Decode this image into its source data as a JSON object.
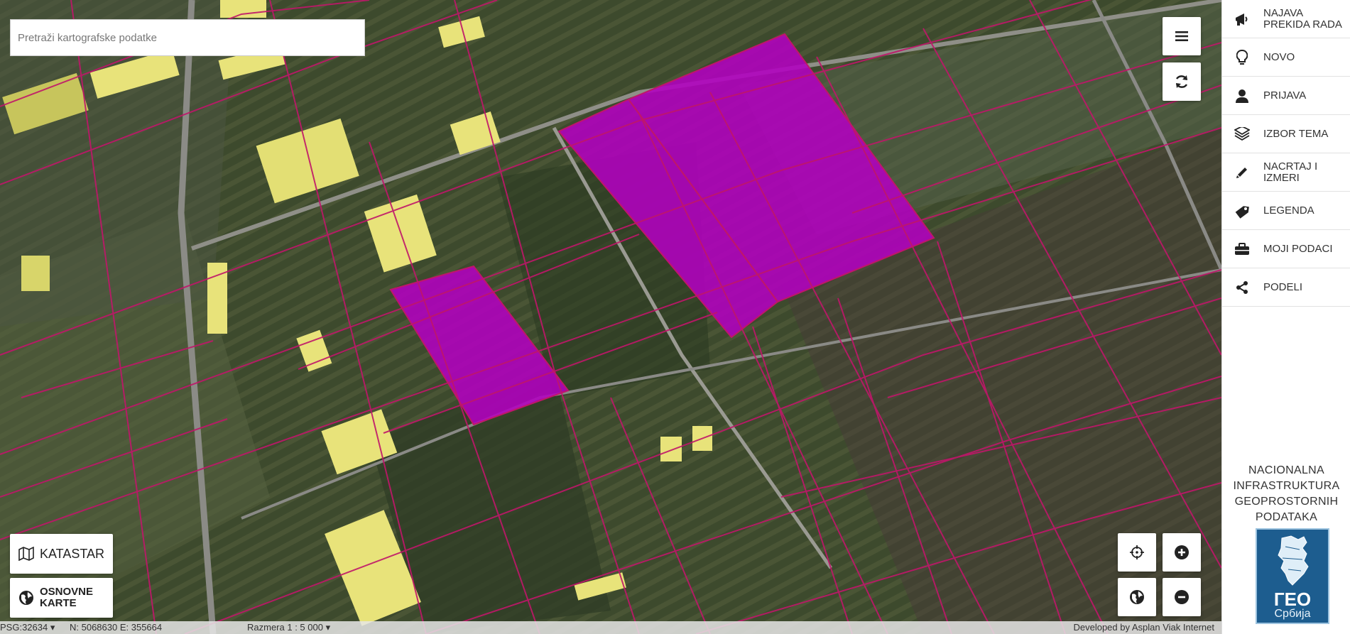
{
  "search": {
    "placeholder": "Pretraži kartografske podatke"
  },
  "buttons": {
    "katastar": "KATASTAR",
    "osnovne_karte": "OSNOVNE KARTE"
  },
  "map_controls": {
    "menu_icon": "hamburger-icon",
    "refresh_icon": "refresh-icon",
    "locate_icon": "crosshair-icon",
    "globe_icon": "globe-icon",
    "zoom_in_icon": "plus-icon",
    "zoom_out_icon": "minus-icon"
  },
  "sidebar": {
    "items": [
      {
        "label": "NAJAVA PREKIDA RADA",
        "icon": "megaphone-icon"
      },
      {
        "label": "NOVO",
        "icon": "lightbulb-icon"
      },
      {
        "label": "PRIJAVA",
        "icon": "user-icon"
      },
      {
        "label": "IZBOR TEMA",
        "icon": "layers-icon"
      },
      {
        "label": "NACRTAJ I IZMERI",
        "icon": "pencil-icon"
      },
      {
        "label": "LEGENDA",
        "icon": "tag-icon"
      },
      {
        "label": "MOJI PODACI",
        "icon": "briefcase-icon"
      },
      {
        "label": "PODELI",
        "icon": "share-icon"
      }
    ],
    "nidp_text": "NACIONALNA INFRASTRUKTURA GEOPROSTORNIH PODATAKA",
    "logo": {
      "title": "ГЕО",
      "subtitle": "Србија"
    }
  },
  "status": {
    "crs": "PSG:32634",
    "coords": "N: 5068630 E: 355664",
    "scale": "Razmera 1 : 5 000",
    "credit": "Developed by Asplan Viak Internet",
    "dropdown_mark": "▾"
  },
  "colors": {
    "parcel_line": "#c0166a",
    "highlight": "#b300c0",
    "building": "#e8e37a"
  }
}
